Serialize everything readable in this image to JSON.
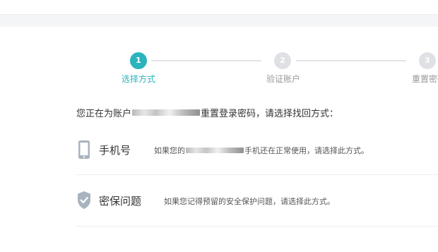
{
  "steps": [
    {
      "number": "1",
      "label": "选择方式",
      "state": "active"
    },
    {
      "number": "2",
      "label": "验证账户",
      "state": "inactive"
    },
    {
      "number": "3",
      "label": "重置密码",
      "state": "inactive"
    }
  ],
  "instruction": {
    "prefix": "您正在为账户",
    "suffix": "重置登录密码，请选择找回方式："
  },
  "options": [
    {
      "icon": "phone-icon",
      "title": "手机号",
      "desc_prefix": "如果您的",
      "desc_suffix": "手机还在正常使用，请选择此方式。"
    },
    {
      "icon": "shield-check-icon",
      "title": "密保问题",
      "desc_prefix": "如果您记得预留的安全保护问题，请选择此方式。",
      "desc_suffix": ""
    }
  ],
  "colors": {
    "accent": "#2bb3be",
    "inactive": "#dfe1e5",
    "text": "#333333"
  }
}
